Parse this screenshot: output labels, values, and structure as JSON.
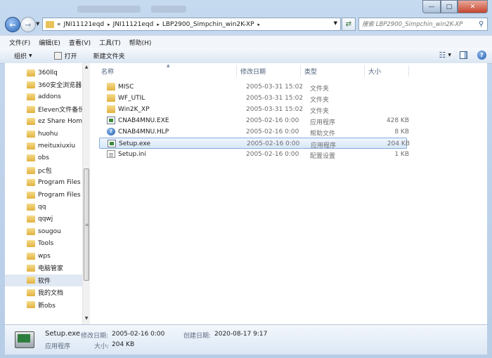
{
  "window": {
    "buttons": {
      "minimize": "—",
      "maximize": "□",
      "close": "✕"
    }
  },
  "address": {
    "overflow": "«",
    "crumbs": [
      "JNI11121eqd",
      "JNI11121eqd",
      "LBP2900_Simpchin_win2K-XP"
    ],
    "search_placeholder": "搜索 LBP2900_Simpchin_win2K-XP"
  },
  "menu": [
    "文件(F)",
    "编辑(E)",
    "查看(V)",
    "工具(T)",
    "帮助(H)"
  ],
  "toolbar": {
    "organize": "组织",
    "open": "打开",
    "new_folder": "新建文件夹"
  },
  "nav": {
    "items": [
      {
        "label": "360llq"
      },
      {
        "label": "360安全浏览器"
      },
      {
        "label": "addons"
      },
      {
        "label": "Eleven文件备份"
      },
      {
        "label": "ez Share Home"
      },
      {
        "label": "huohu"
      },
      {
        "label": "meituxiuxiu"
      },
      {
        "label": "obs"
      },
      {
        "label": "pc包"
      },
      {
        "label": "Program Files"
      },
      {
        "label": "Program Files"
      },
      {
        "label": "qq"
      },
      {
        "label": "qqwj"
      },
      {
        "label": "sougou"
      },
      {
        "label": "Tools"
      },
      {
        "label": "wps"
      },
      {
        "label": "电脑管家"
      },
      {
        "label": "软件",
        "selected": true
      },
      {
        "label": "我的文档"
      },
      {
        "label": "新obs"
      }
    ]
  },
  "columns": {
    "name": "名称",
    "date": "修改日期",
    "type": "类型",
    "size": "大小"
  },
  "files": [
    {
      "name": "MISC",
      "date": "2005-03-31 15:02",
      "type": "文件夹",
      "size": "",
      "icon": "folder"
    },
    {
      "name": "WF_UTIL",
      "date": "2005-03-31 15:02",
      "type": "文件夹",
      "size": "",
      "icon": "folder"
    },
    {
      "name": "Win2K_XP",
      "date": "2005-03-31 15:02",
      "type": "文件夹",
      "size": "",
      "icon": "folder"
    },
    {
      "name": "CNAB4MNU.EXE",
      "date": "2005-02-16 0:00",
      "type": "应用程序",
      "size": "428 KB",
      "icon": "exe"
    },
    {
      "name": "CNAB4MNU.HLP",
      "date": "2005-02-16 0:00",
      "type": "帮助文件",
      "size": "8 KB",
      "icon": "hlp"
    },
    {
      "name": "Setup.exe",
      "date": "2005-02-16 0:00",
      "type": "应用程序",
      "size": "204 KB",
      "icon": "exe",
      "selected": true
    },
    {
      "name": "Setup.ini",
      "date": "2005-02-16 0:00",
      "type": "配置设置",
      "size": "1 KB",
      "icon": "ini"
    }
  ],
  "details": {
    "name": "Setup.exe",
    "modified_label": "修改日期:",
    "modified": "2005-02-16 0:00",
    "created_label": "创建日期:",
    "created": "2020-08-17 9:17",
    "type": "应用程序",
    "size_label": "大小:",
    "size": "204 KB"
  }
}
